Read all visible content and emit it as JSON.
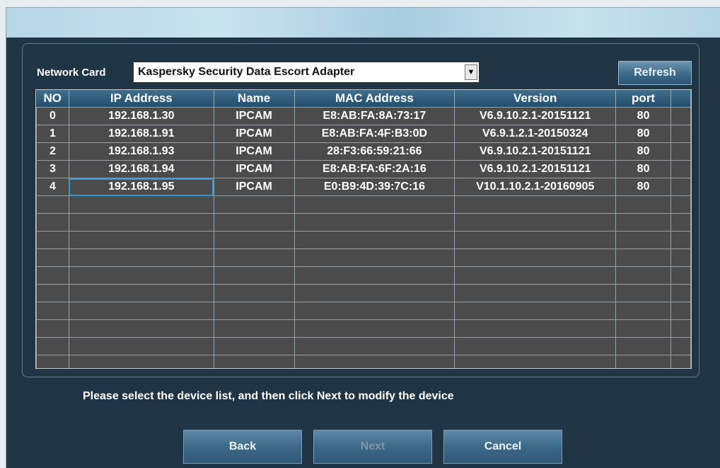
{
  "network_card": {
    "label": "Network Card",
    "selected": "Kaspersky Security Data Escort Adapter",
    "refresh_label": "Refresh"
  },
  "table": {
    "columns": [
      "NO",
      "IP Address",
      "Name",
      "MAC Address",
      "Version",
      "port"
    ],
    "rows": [
      {
        "no": "0",
        "ip": "192.168.1.30",
        "name": "IPCAM",
        "mac": "E8:AB:FA:8A:73:17",
        "version": "V6.9.10.2.1-20151121",
        "port": "80"
      },
      {
        "no": "1",
        "ip": "192.168.1.91",
        "name": "IPCAM",
        "mac": "E8:AB:FA:4F:B3:0D",
        "version": "V6.9.1.2.1-20150324",
        "port": "80"
      },
      {
        "no": "2",
        "ip": "192.168.1.93",
        "name": "IPCAM",
        "mac": "28:F3:66:59:21:66",
        "version": "V6.9.10.2.1-20151121",
        "port": "80"
      },
      {
        "no": "3",
        "ip": "192.168.1.94",
        "name": "IPCAM",
        "mac": "E8:AB:FA:6F:2A:16",
        "version": "V6.9.10.2.1-20151121",
        "port": "80"
      },
      {
        "no": "4",
        "ip": "192.168.1.95",
        "name": "IPCAM",
        "mac": "E0:B9:4D:39:7C:16",
        "version": "V10.1.10.2.1-20160905",
        "port": "80"
      }
    ],
    "selected_row": 4
  },
  "hint": "Please select the device list, and then click Next to modify the device",
  "buttons": {
    "back": "Back",
    "next": "Next",
    "cancel": "Cancel"
  },
  "colors": {
    "window_bg": "#1f3444",
    "grid_bg": "#4b4b4b",
    "selection_outline": "#2f95d4"
  }
}
